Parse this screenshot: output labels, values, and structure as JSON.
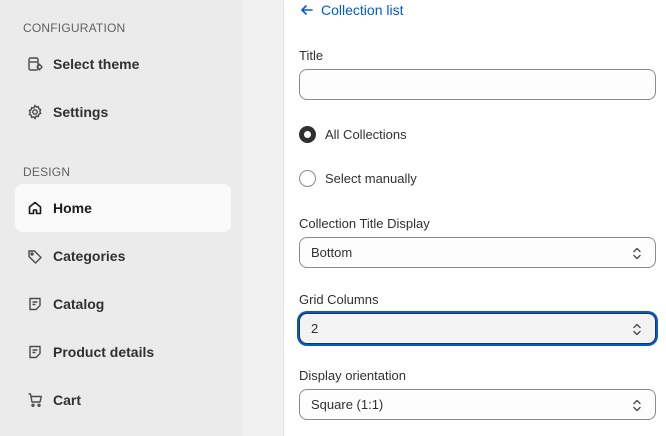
{
  "sidebar": {
    "sections": [
      {
        "label": "CONFIGURATION"
      },
      {
        "label": "DESIGN"
      }
    ],
    "items": [
      {
        "label": "Select theme",
        "icon": "theme-icon"
      },
      {
        "label": "Settings",
        "icon": "gear-icon"
      },
      {
        "label": "Home",
        "icon": "home-icon",
        "active": true
      },
      {
        "label": "Categories",
        "icon": "tag-icon"
      },
      {
        "label": "Catalog",
        "icon": "document-icon"
      },
      {
        "label": "Product details",
        "icon": "document-icon"
      },
      {
        "label": "Cart",
        "icon": "cart-icon"
      }
    ]
  },
  "main": {
    "back_link": "Collection list",
    "title_field": {
      "label": "Title",
      "value": "",
      "placeholder": ""
    },
    "radios": [
      {
        "label": "All Collections",
        "checked": true
      },
      {
        "label": "Select manually",
        "checked": false
      }
    ],
    "title_display": {
      "label": "Collection Title Display",
      "value": "Bottom"
    },
    "grid_columns": {
      "label": "Grid Columns",
      "value": "2"
    },
    "orientation": {
      "label": "Display orientation",
      "value": "Square (1:1)"
    }
  },
  "colors": {
    "link": "#005bd3",
    "sidebar_bg": "#ebebeb",
    "active_item_bg": "#fafafa",
    "focus_ring": "#005bd3"
  }
}
